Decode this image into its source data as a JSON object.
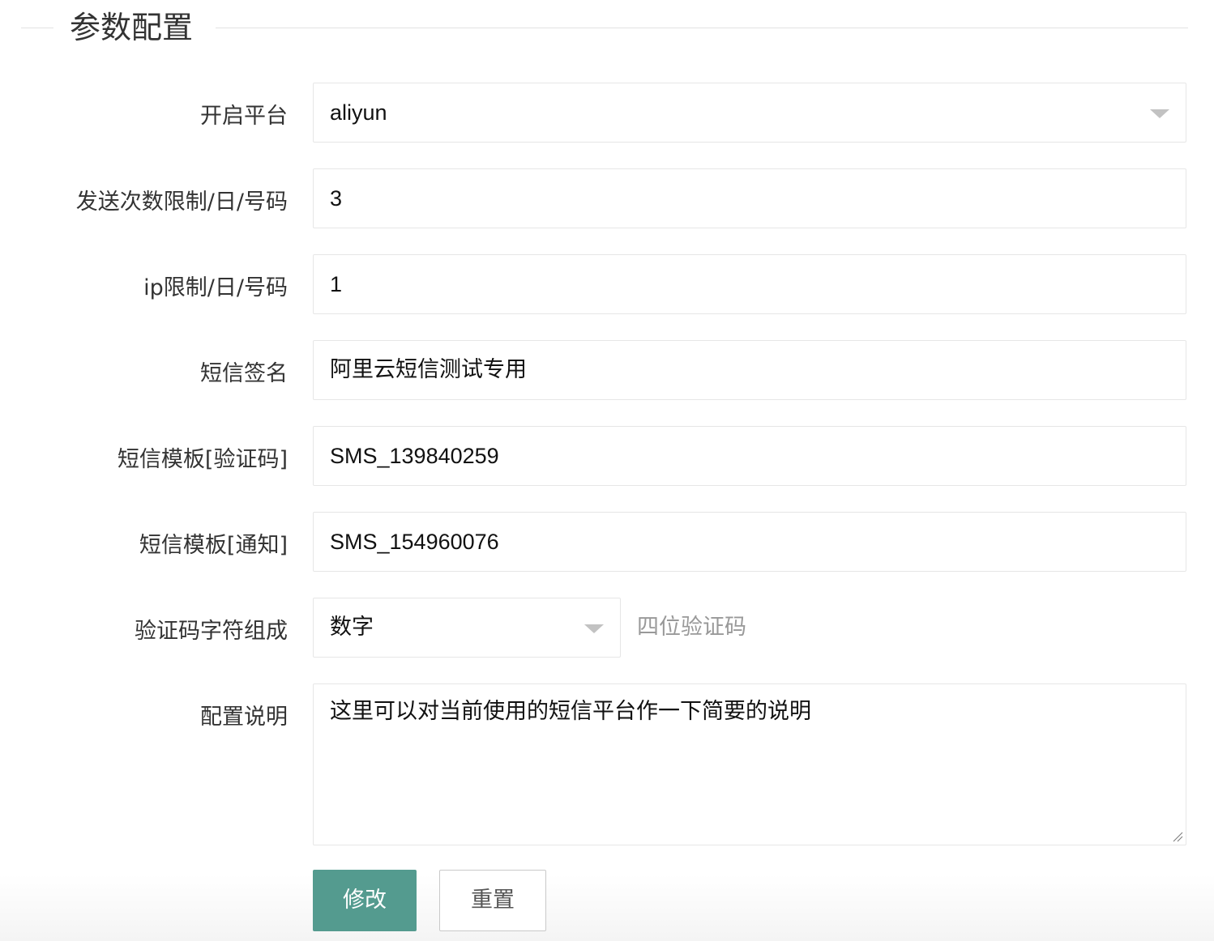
{
  "legend": {
    "title": "参数配置"
  },
  "form": {
    "platform": {
      "label": "开启平台",
      "value": "aliyun"
    },
    "send_limit": {
      "label": "发送次数限制/日/号码",
      "value": "3"
    },
    "ip_limit": {
      "label": "ip限制/日/号码",
      "value": "1"
    },
    "signature": {
      "label": "短信签名",
      "value": "阿里云短信测试专用"
    },
    "template_verify": {
      "label": "短信模板[验证码]",
      "value": "SMS_139840259"
    },
    "template_notify": {
      "label": "短信模板[通知]",
      "value": "SMS_154960076"
    },
    "code_charset": {
      "label": "验证码字符组成",
      "value": "数字",
      "hint": "四位验证码"
    },
    "description": {
      "label": "配置说明",
      "value": "这里可以对当前使用的短信平台作一下简要的说明"
    }
  },
  "buttons": {
    "submit": "修改",
    "reset": "重置"
  },
  "icons": {
    "select_caret": "chevron-down-icon",
    "resize": "resize-grip-icon"
  },
  "colors": {
    "primary": "#549b8f",
    "border": "#e6e6e6",
    "hint": "#999999"
  }
}
